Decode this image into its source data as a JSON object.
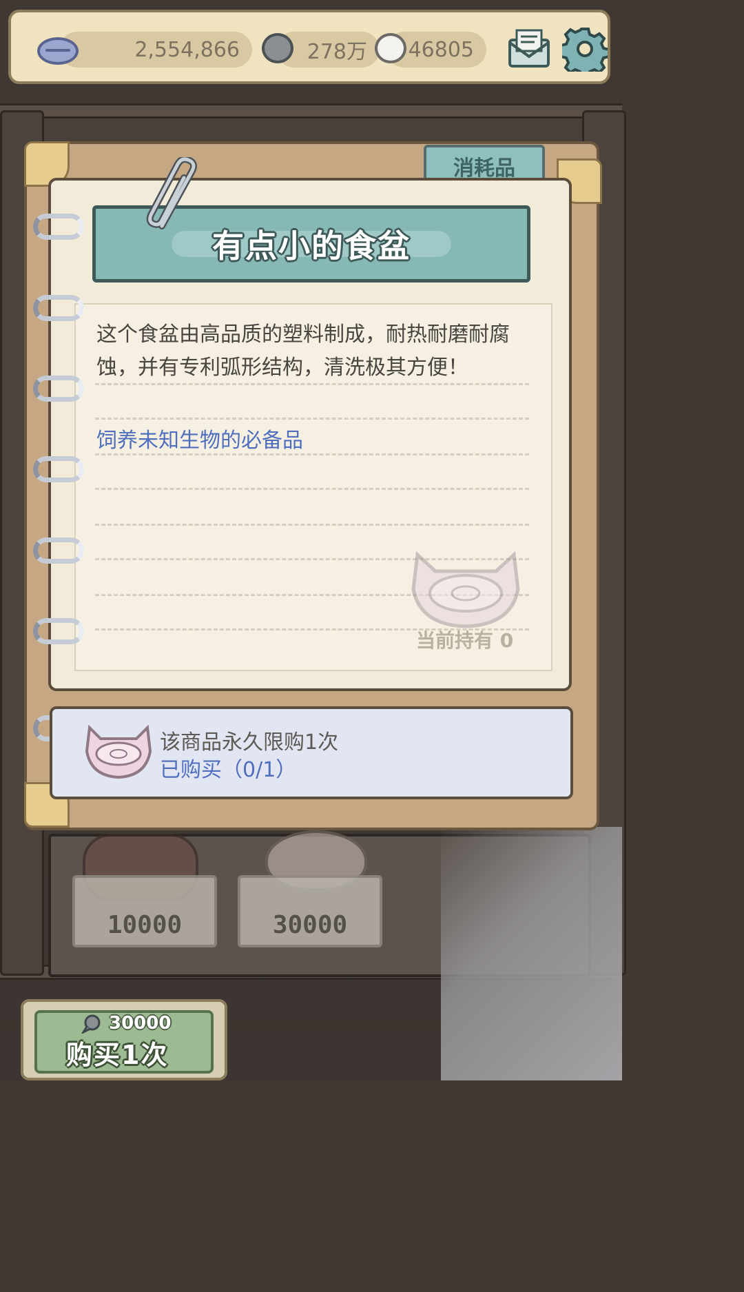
{
  "currency": {
    "coins": "2,554,866",
    "dark_bubbles": "278万",
    "light_bubbles": "46805"
  },
  "icons": {
    "coin": "coin-icon",
    "dark_bubble": "speech-bubble-dark-icon",
    "light_bubble": "speech-bubble-light-icon",
    "mail": "mail-icon",
    "settings": "gear-icon"
  },
  "notebook": {
    "category_tab": "消耗品",
    "title": "有点小的食盆",
    "description": "这个食盆由高品质的塑料制成，耐热耐磨耐腐蚀，并有专利弧形结构，清洗极其方便！",
    "note": "饲养未知生物的必备品",
    "held_label": "当前持有",
    "held_count": "0"
  },
  "purchase_info": {
    "limit_text": "该商品永久限购1次",
    "bought_text": "已购买（0/1）"
  },
  "shelf": {
    "prices": [
      "10000",
      "30000"
    ]
  },
  "buy_button": {
    "price": "30000",
    "label": "购买1次"
  },
  "colors": {
    "accent_teal": "#86b8b5",
    "note_blue": "#4f6fbe",
    "buy_green": "#9dbb92"
  }
}
